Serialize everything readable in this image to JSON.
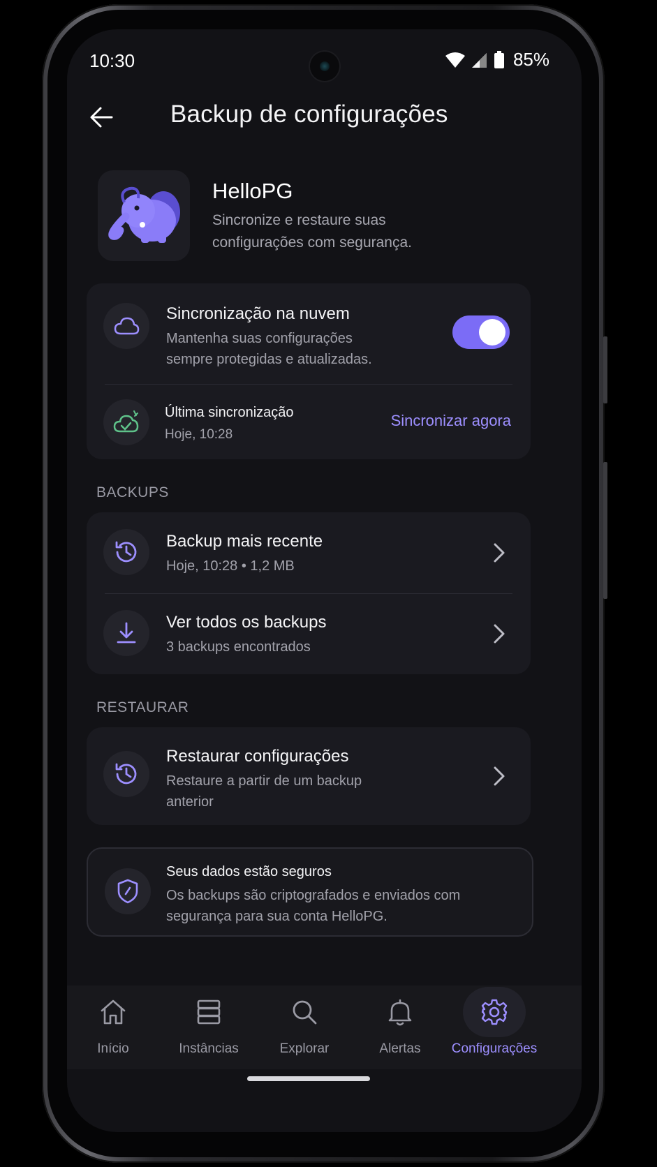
{
  "status": {
    "time": "10:30",
    "battery": "85%"
  },
  "header": {
    "title": "Backup de configurações",
    "back_icon": "arrow-left-icon"
  },
  "app": {
    "name": "HelloPG",
    "description": "Sincronize e restaure suas configurações com segurança.",
    "logo_icon": "elephant-logo-icon"
  },
  "cloud_sync": {
    "title": "Sincronização na nuvem",
    "subtitle": "Mantenha suas configurações sempre protegidas e atualizadas.",
    "enabled": true,
    "last_sync_label": "Última sincronização",
    "last_sync_value": "Hoje, 10:28",
    "sync_now_label": "Sincronizar agora"
  },
  "backups": {
    "section_label": "BACKUPS",
    "items": [
      {
        "title": "Backup mais recente",
        "subtitle": "Hoje, 10:28 • 1,2 MB",
        "icon": "history-icon"
      },
      {
        "title": "Ver todos os backups",
        "subtitle": "3 backups encontrados",
        "icon": "download-icon"
      }
    ]
  },
  "restore": {
    "section_label": "RESTAURAR",
    "title": "Restaurar configurações",
    "subtitle": "Restaure a partir de um backup anterior",
    "icon": "restore-icon"
  },
  "security": {
    "title": "Seus dados estão seguros",
    "subtitle": "Os backups são criptografados e enviados com segurança para sua conta HelloPG.",
    "icon": "shield-icon"
  },
  "nav": {
    "items": [
      {
        "label": "Início",
        "icon": "home-icon"
      },
      {
        "label": "Instâncias",
        "icon": "server-icon"
      },
      {
        "label": "Explorar",
        "icon": "search-icon"
      },
      {
        "label": "Alertas",
        "icon": "bell-icon"
      },
      {
        "label": "Configurações",
        "icon": "gear-icon",
        "active": true
      }
    ]
  },
  "colors": {
    "accent": "#7b6cf6",
    "accent_text": "#9d8fff",
    "success": "#5fc28a",
    "background": "#121216",
    "card": "#1a1a20"
  }
}
